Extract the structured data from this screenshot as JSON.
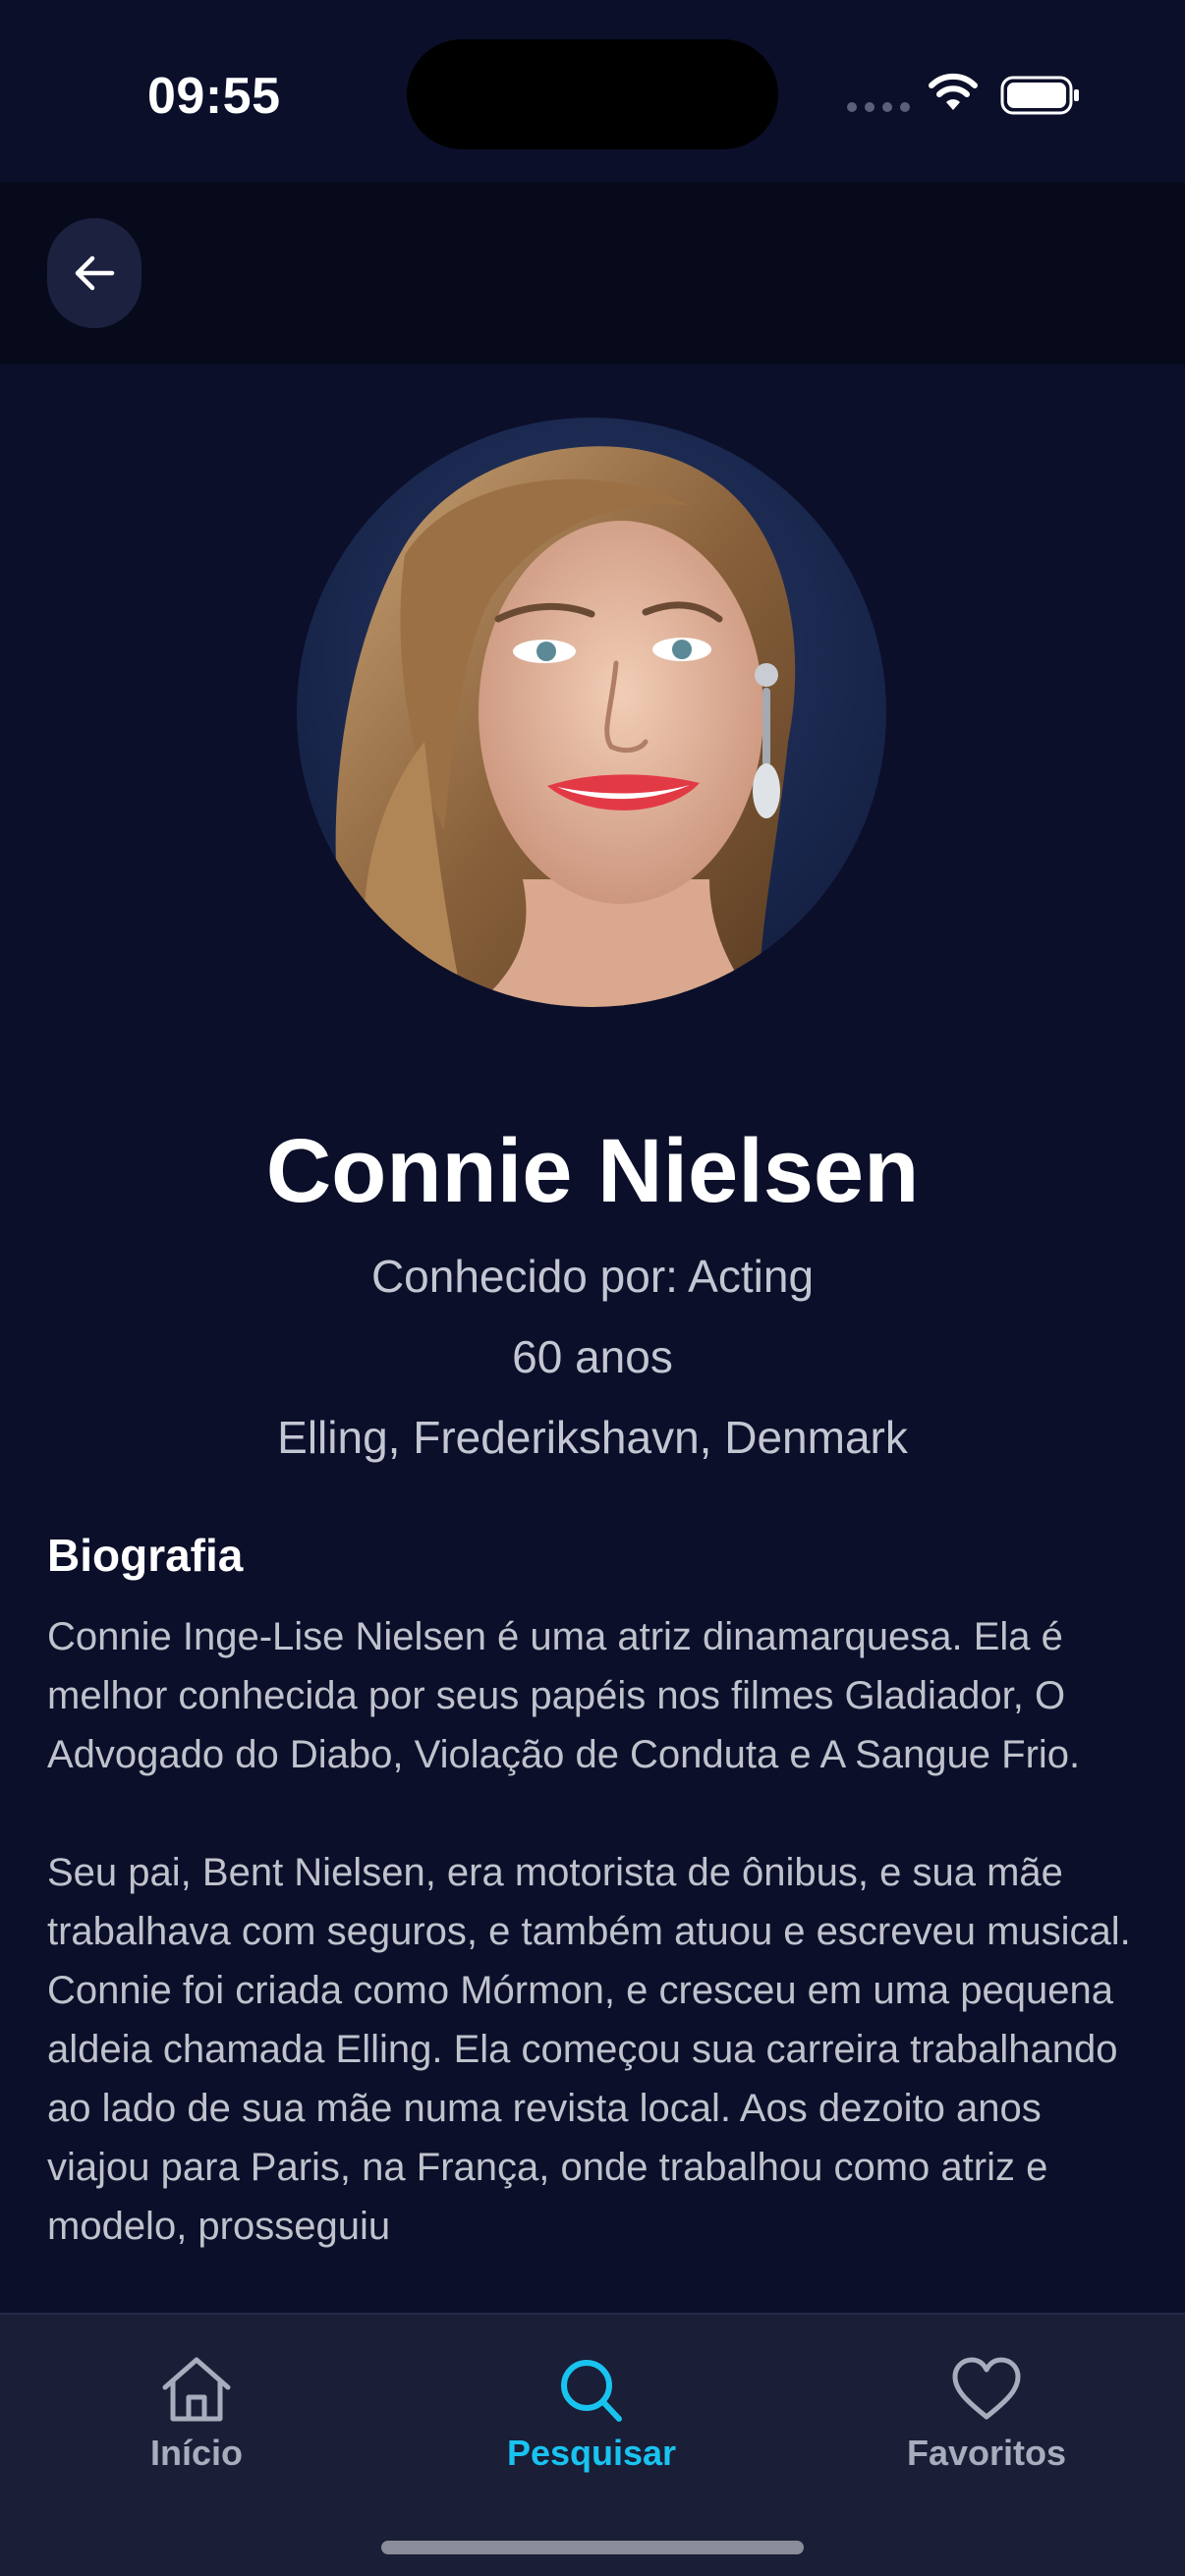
{
  "status_bar": {
    "time": "09:55"
  },
  "header": {
    "back_icon": "arrow-left-icon"
  },
  "person": {
    "name": "Connie Nielsen",
    "known_for": "Conhecido por: Acting",
    "age": "60 anos",
    "birthplace": "Elling, Frederikshavn, Denmark"
  },
  "biography": {
    "heading": "Biografia",
    "paragraphs": [
      "Connie Inge-Lise Nielsen é uma atriz dinamarquesa. Ela é melhor conhecida por seus papéis nos filmes Gladiador, O Advogado do Diabo, Violação de Conduta e A Sangue Frio.",
      "Seu pai, Bent Nielsen, era motorista de ônibus, e sua mãe trabalhava com seguros, e também atuou e escreveu musical. Connie foi criada como Mórmon, e cresceu em uma pequena aldeia chamada Elling. Ela começou sua carreira trabalhando ao lado de sua mãe numa revista local. Aos dezoito anos viajou para Paris, na França, onde trabalhou como atriz e modelo, prosseguiu"
    ]
  },
  "tab_bar": {
    "tabs": [
      {
        "label": "Início",
        "icon": "home-icon",
        "active": false
      },
      {
        "label": "Pesquisar",
        "icon": "search-icon",
        "active": true
      },
      {
        "label": "Favoritos",
        "icon": "heart-icon",
        "active": false
      }
    ]
  },
  "colors": {
    "background": "#0b0f2a",
    "header": "#070a1b",
    "tab_bar": "#1a1e36",
    "accent": "#19c3f0",
    "muted_text": "#c4c6d2"
  }
}
